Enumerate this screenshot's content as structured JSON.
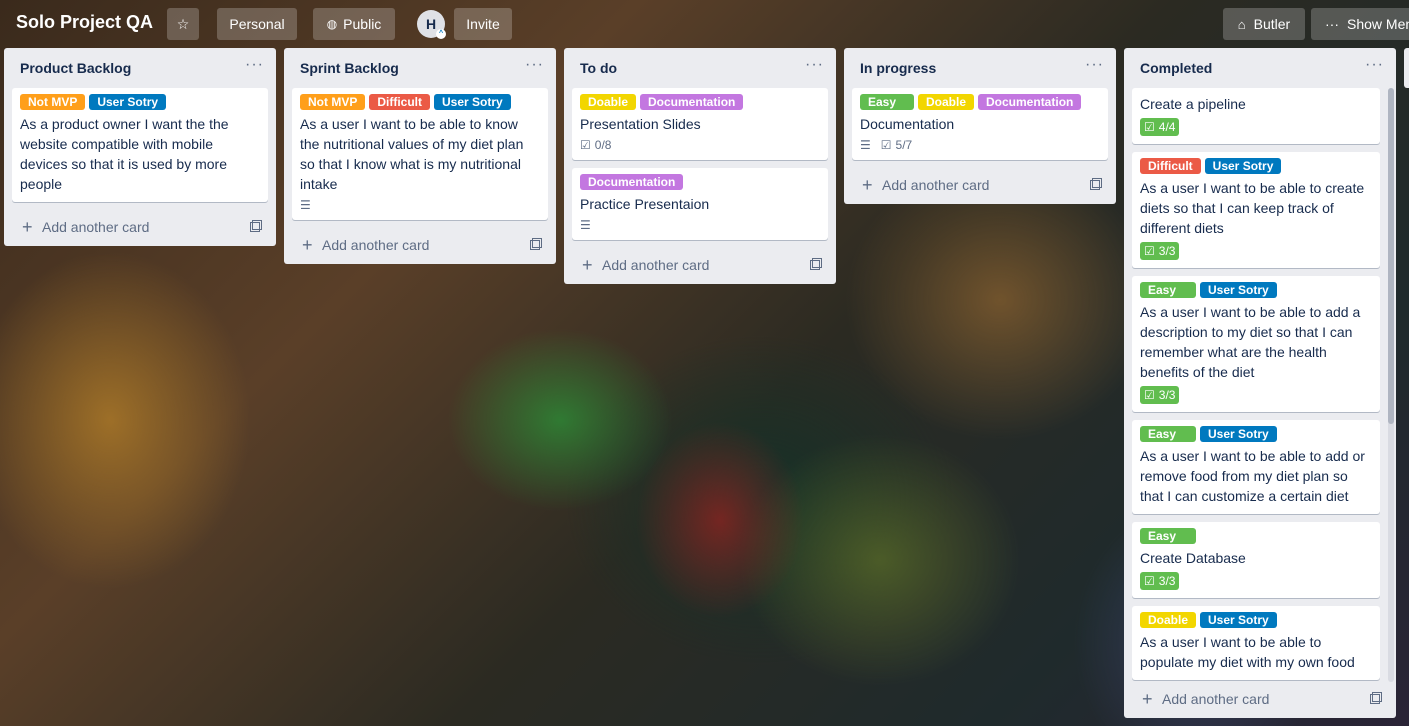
{
  "board": {
    "title": "Solo Project QA",
    "visibility_personal": "Personal",
    "visibility_public": "Public",
    "avatar_initial": "H",
    "invite": "Invite",
    "butler": "Butler",
    "show_menu": "Show Menu"
  },
  "colors": {
    "orange": "#ff9f1a",
    "blue": "#0079bf",
    "red": "#eb5a46",
    "yellow": "#f2d600",
    "purple": "#c377e0",
    "green": "#61bd4f"
  },
  "lists": [
    {
      "title": "Product Backlog",
      "menu": "···",
      "add_card": "Add another card",
      "cards": [
        {
          "labels": [
            {
              "text": "Not MVP",
              "color": "orange"
            },
            {
              "text": "User Sotry",
              "color": "blue"
            }
          ],
          "text": "As a product owner I want the the website compatible with mobile devices so that it is used by more people"
        }
      ]
    },
    {
      "title": "Sprint Backlog",
      "menu": "···",
      "add_card": "Add another card",
      "cards": [
        {
          "labels": [
            {
              "text": "Not MVP",
              "color": "orange"
            },
            {
              "text": "Difficult",
              "color": "red"
            },
            {
              "text": "User Sotry",
              "color": "blue"
            }
          ],
          "text": "As a user I want to be able to know the nutritional values of my diet plan so that I know what is my nutritional intake",
          "has_description": true
        }
      ]
    },
    {
      "title": "To do",
      "menu": "···",
      "add_card": "Add another card",
      "cards": [
        {
          "labels": [
            {
              "text": "Doable",
              "color": "yellow"
            },
            {
              "text": "Documentation",
              "color": "purple"
            }
          ],
          "text": "Presentation Slides",
          "checklist": "0/8"
        },
        {
          "labels": [
            {
              "text": "Documentation",
              "color": "purple"
            }
          ],
          "text": "Practice Presentaion",
          "has_description": true
        }
      ]
    },
    {
      "title": "In progress",
      "menu": "···",
      "add_card": "Add another card",
      "cards": [
        {
          "labels": [
            {
              "text": "Easy",
              "color": "green"
            },
            {
              "text": "Doable",
              "color": "yellow"
            },
            {
              "text": "Documentation",
              "color": "purple"
            }
          ],
          "text": "Documentation",
          "has_description": true,
          "checklist": "5/7"
        }
      ]
    },
    {
      "title": "Completed",
      "menu": "···",
      "add_card": "Add another card",
      "cards": [
        {
          "labels": [],
          "text": "Create a pipeline",
          "checklist_done": "4/4"
        },
        {
          "labels": [
            {
              "text": "Difficult",
              "color": "red"
            },
            {
              "text": "User Sotry",
              "color": "blue"
            }
          ],
          "text": "As a user I want to be able to create diets so that I can keep track of different diets",
          "checklist_done": "3/3"
        },
        {
          "labels": [
            {
              "text": "Easy",
              "color": "green"
            },
            {
              "text": "User Sotry",
              "color": "blue"
            }
          ],
          "text": "As a user I want to be able to add a description to my diet so that I can remember what are the health benefits of the diet",
          "checklist_done": "3/3"
        },
        {
          "labels": [
            {
              "text": "Easy",
              "color": "green"
            },
            {
              "text": "User Sotry",
              "color": "blue"
            }
          ],
          "text": "As a user I want to be able to add or remove food from my diet plan so that I can customize a certain diet"
        },
        {
          "labels": [
            {
              "text": "Easy",
              "color": "green"
            }
          ],
          "text": "Create Database",
          "checklist_done": "3/3"
        },
        {
          "labels": [
            {
              "text": "Doable",
              "color": "yellow"
            },
            {
              "text": "User Sotry",
              "color": "blue"
            }
          ],
          "text": "As a user I want to be able to populate my diet with my own food"
        }
      ]
    }
  ]
}
